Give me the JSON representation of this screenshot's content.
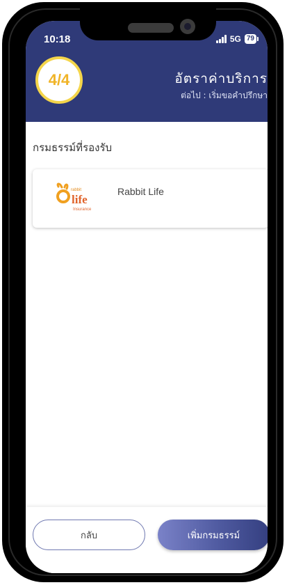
{
  "status_bar": {
    "time": "10:18",
    "network": "5G",
    "battery": "79"
  },
  "header": {
    "step": "4/4",
    "title": "อัตราค่าบริการ",
    "next": "ต่อไป : เริ่มขอคำปรึกษา"
  },
  "section": {
    "title": "กรมธรรม์ที่รองรับ"
  },
  "policies": [
    {
      "name": "Rabbit Life",
      "logo": {
        "text_top": "rabbit",
        "text_main": "life",
        "text_sub": "Insurance"
      }
    }
  ],
  "buttons": {
    "back": "กลับ",
    "add": "เพิ่มกรมธรรม์"
  },
  "colors": {
    "header_bg": "#2f3a78",
    "step_ring": "#f4d54a",
    "step_text": "#f0b428",
    "accent": "#4f5aa0"
  },
  "icons": {
    "signal": "cellular-signal-icon",
    "battery": "battery-icon"
  }
}
